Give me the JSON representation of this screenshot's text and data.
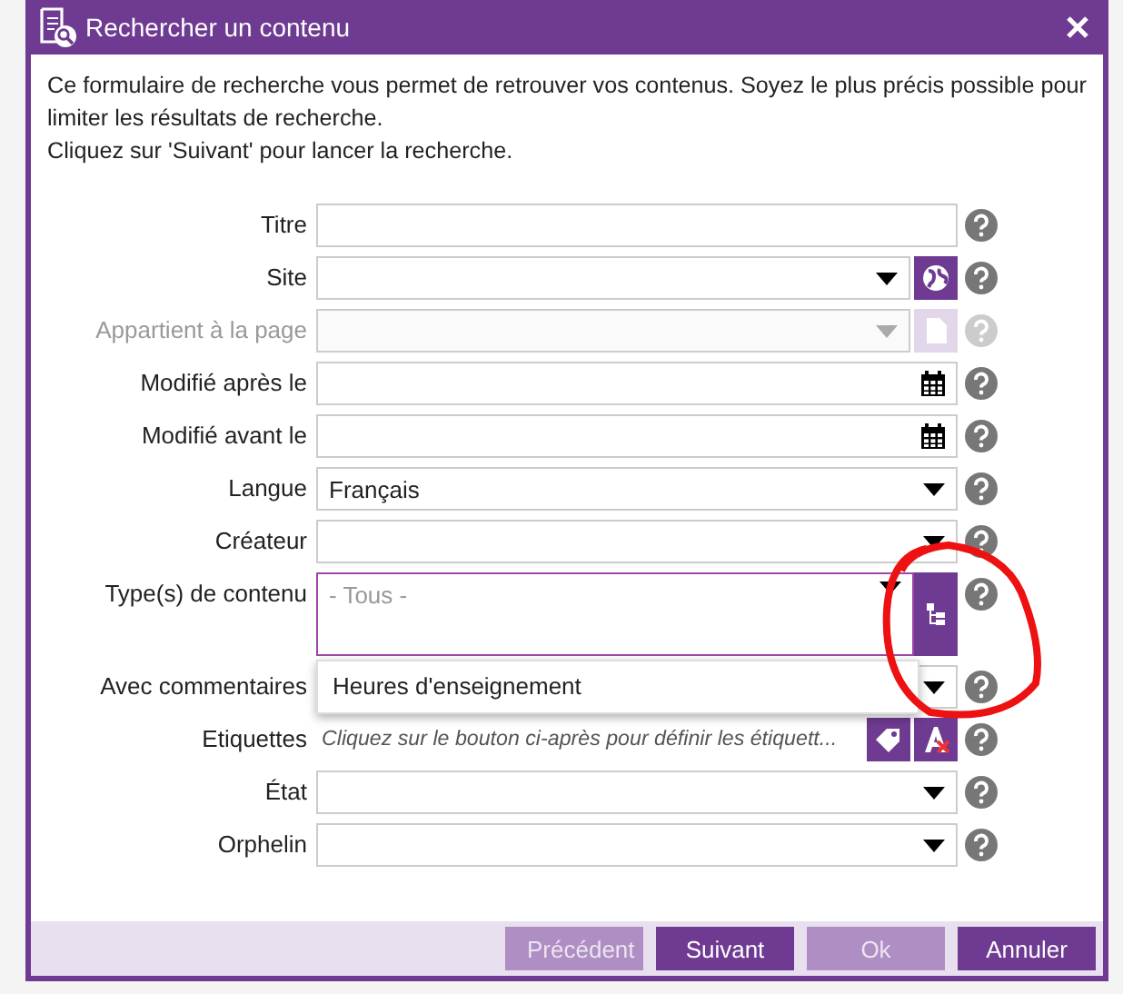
{
  "window": {
    "title": "Rechercher un contenu"
  },
  "intro": [
    "Ce formulaire de recherche vous permet de retrouver vos contenus. Soyez le plus précis possible pour limiter les résultats de recherche.",
    "Cliquez sur 'Suivant' pour lancer la recherche."
  ],
  "fields": [
    {
      "label": "Titre",
      "kind": "text",
      "disabled": false
    },
    {
      "label": "Site",
      "kind": "select",
      "disabled": false,
      "buttons": [
        {
          "kind": "globe"
        }
      ]
    },
    {
      "label": "Appartient à la page",
      "kind": "select",
      "disabled": true,
      "buttons": [
        {
          "kind": "page"
        }
      ]
    },
    {
      "label": "Modifié après le",
      "kind": "date",
      "disabled": false
    },
    {
      "label": "Modifié avant le",
      "kind": "date",
      "disabled": false
    },
    {
      "label": "Langue",
      "kind": "select",
      "value": "Français",
      "disabled": false
    },
    {
      "label": "Créateur",
      "kind": "select",
      "disabled": false
    },
    {
      "label": "Type(s) de contenu",
      "kind": "multi",
      "placeholder": "- Tous -",
      "disabled": false,
      "buttons": [
        {
          "kind": "tree"
        }
      ],
      "dropdown": [
        "Heures d'enseignement"
      ]
    },
    {
      "label": "Avec commentaires",
      "kind": "select",
      "disabled": false
    },
    {
      "label": "Etiquettes",
      "kind": "tags",
      "hint": "Cliquez sur le bouton ci-après pour définir les étiquett...",
      "disabled": false,
      "buttons": [
        {
          "kind": "tag"
        },
        {
          "kind": "clear"
        }
      ]
    },
    {
      "label": "État",
      "kind": "select",
      "disabled": false
    },
    {
      "label": "Orphelin",
      "kind": "select",
      "disabled": false
    }
  ],
  "buttons": [
    {
      "label": "Précédent",
      "disabled": true
    },
    {
      "label": "Suivant",
      "disabled": false
    },
    {
      "label": "Ok",
      "disabled": true
    },
    {
      "label": "Annuler",
      "disabled": false
    }
  ]
}
